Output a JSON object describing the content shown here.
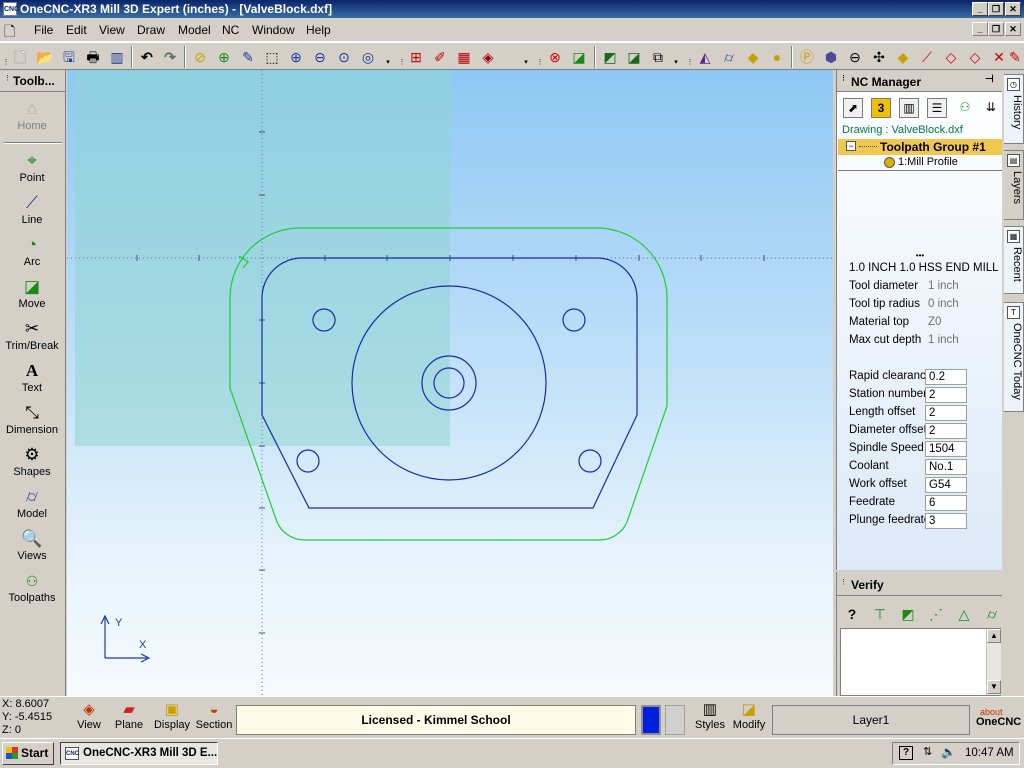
{
  "window": {
    "title": "OneCNC-XR3 Mill 3D Expert (inches) - [ValveBlock.dxf]",
    "icon_text": "CNC"
  },
  "menu": [
    "File",
    "Edit",
    "View",
    "Draw",
    "Model",
    "NC",
    "Window",
    "Help"
  ],
  "toolbar_icons": [
    "new-file-icon",
    "open-folder-icon",
    "save-icon",
    "print-icon",
    "book-icon",
    "undo-icon",
    "redo-icon",
    "zoom-extents-icon",
    "zoom-window-icon",
    "pencil-icon",
    "select-icon",
    "zoom-in-icon",
    "zoom-out-icon",
    "zoom-fit-icon",
    "zoom-previous-icon",
    "add-entity-icon",
    "pen-edit-icon",
    "grid-icon",
    "layers-stack-icon",
    "stop-icon",
    "move-icon",
    "hatch-icon",
    "trim-icon",
    "window-icon",
    "solid-cone-icon",
    "solid-cylinder-icon",
    "solid-box-icon",
    "solid-shape-icon",
    "p-icon",
    "cube-icon",
    "dish-icon",
    "arrows-icon",
    "block-icon",
    "tool-icon",
    "diamond-icon",
    "diamond-alt-icon",
    "cross-icon",
    "pen-icon"
  ],
  "left_toolbar": {
    "header": "Toolb...",
    "items": [
      {
        "label": "Home",
        "icon": "home-icon",
        "disabled": true
      },
      {
        "label": "Point",
        "icon": "point-icon"
      },
      {
        "label": "Line",
        "icon": "line-icon"
      },
      {
        "label": "Arc",
        "icon": "arc-icon"
      },
      {
        "label": "Move",
        "icon": "move-icon"
      },
      {
        "label": "Trim/Break",
        "icon": "scissors-icon"
      },
      {
        "label": "Text",
        "icon": "text-icon"
      },
      {
        "label": "Dimension",
        "icon": "dimension-icon"
      },
      {
        "label": "Shapes",
        "icon": "shapes-icon"
      },
      {
        "label": "Model",
        "icon": "model-icon"
      },
      {
        "label": "Views",
        "icon": "views-icon"
      },
      {
        "label": "Toolpaths",
        "icon": "toolpaths-icon"
      }
    ]
  },
  "canvas": {
    "axis_y_label": "Y",
    "axis_x_label": "X",
    "colors": {
      "part": "#1a2aa8",
      "toolpath": "#22cc33",
      "selection": "#8fd6d0"
    }
  },
  "nc_manager": {
    "title": "NC Manager",
    "pin": "ᐅ",
    "drawing": "Drawing : ValveBlock.dxf",
    "group": "Toolpath Group #1",
    "operation": "1:Mill Profile",
    "tool_name": "1.0 INCH 1.0 HSS END MILL",
    "readonly_props": [
      {
        "label": "Tool diameter",
        "value": "1 inch"
      },
      {
        "label": "Tool tip radius",
        "value": "0 inch"
      },
      {
        "label": "Material top",
        "value": "Z0"
      },
      {
        "label": "Max cut depth",
        "value": "1 inch"
      }
    ],
    "editable_props": [
      {
        "label": "Rapid clearanc",
        "value": "0.2"
      },
      {
        "label": "Station number",
        "value": "2"
      },
      {
        "label": "Length offset",
        "value": "2"
      },
      {
        "label": "Diameter offset",
        "value": "2"
      },
      {
        "label": "Spindle Speed",
        "value": "1504"
      },
      {
        "label": "Coolant",
        "value": "No.1"
      },
      {
        "label": "Work offset",
        "value": "G54"
      },
      {
        "label": "Feedrate",
        "value": "6"
      },
      {
        "label": "Plunge feedrate",
        "value": "3"
      }
    ]
  },
  "verify": {
    "title": "Verify"
  },
  "right_tabs": [
    "History",
    "Layers",
    "Recent",
    "OneCNC Today"
  ],
  "status": {
    "x": "X: 8.6007",
    "y": "Y: -5.4515",
    "z": "Z: 0",
    "buttons": [
      "View",
      "Plane",
      "Display",
      "Section"
    ],
    "license": "Licensed - Kimmel School",
    "right_buttons": [
      "Styles",
      "Modify"
    ],
    "layer": "Layer1",
    "about": "about",
    "brand": "OneCNC"
  },
  "taskbar": {
    "start": "Start",
    "task": "OneCNC-XR3 Mill 3D E...",
    "time": "10:47 AM"
  }
}
